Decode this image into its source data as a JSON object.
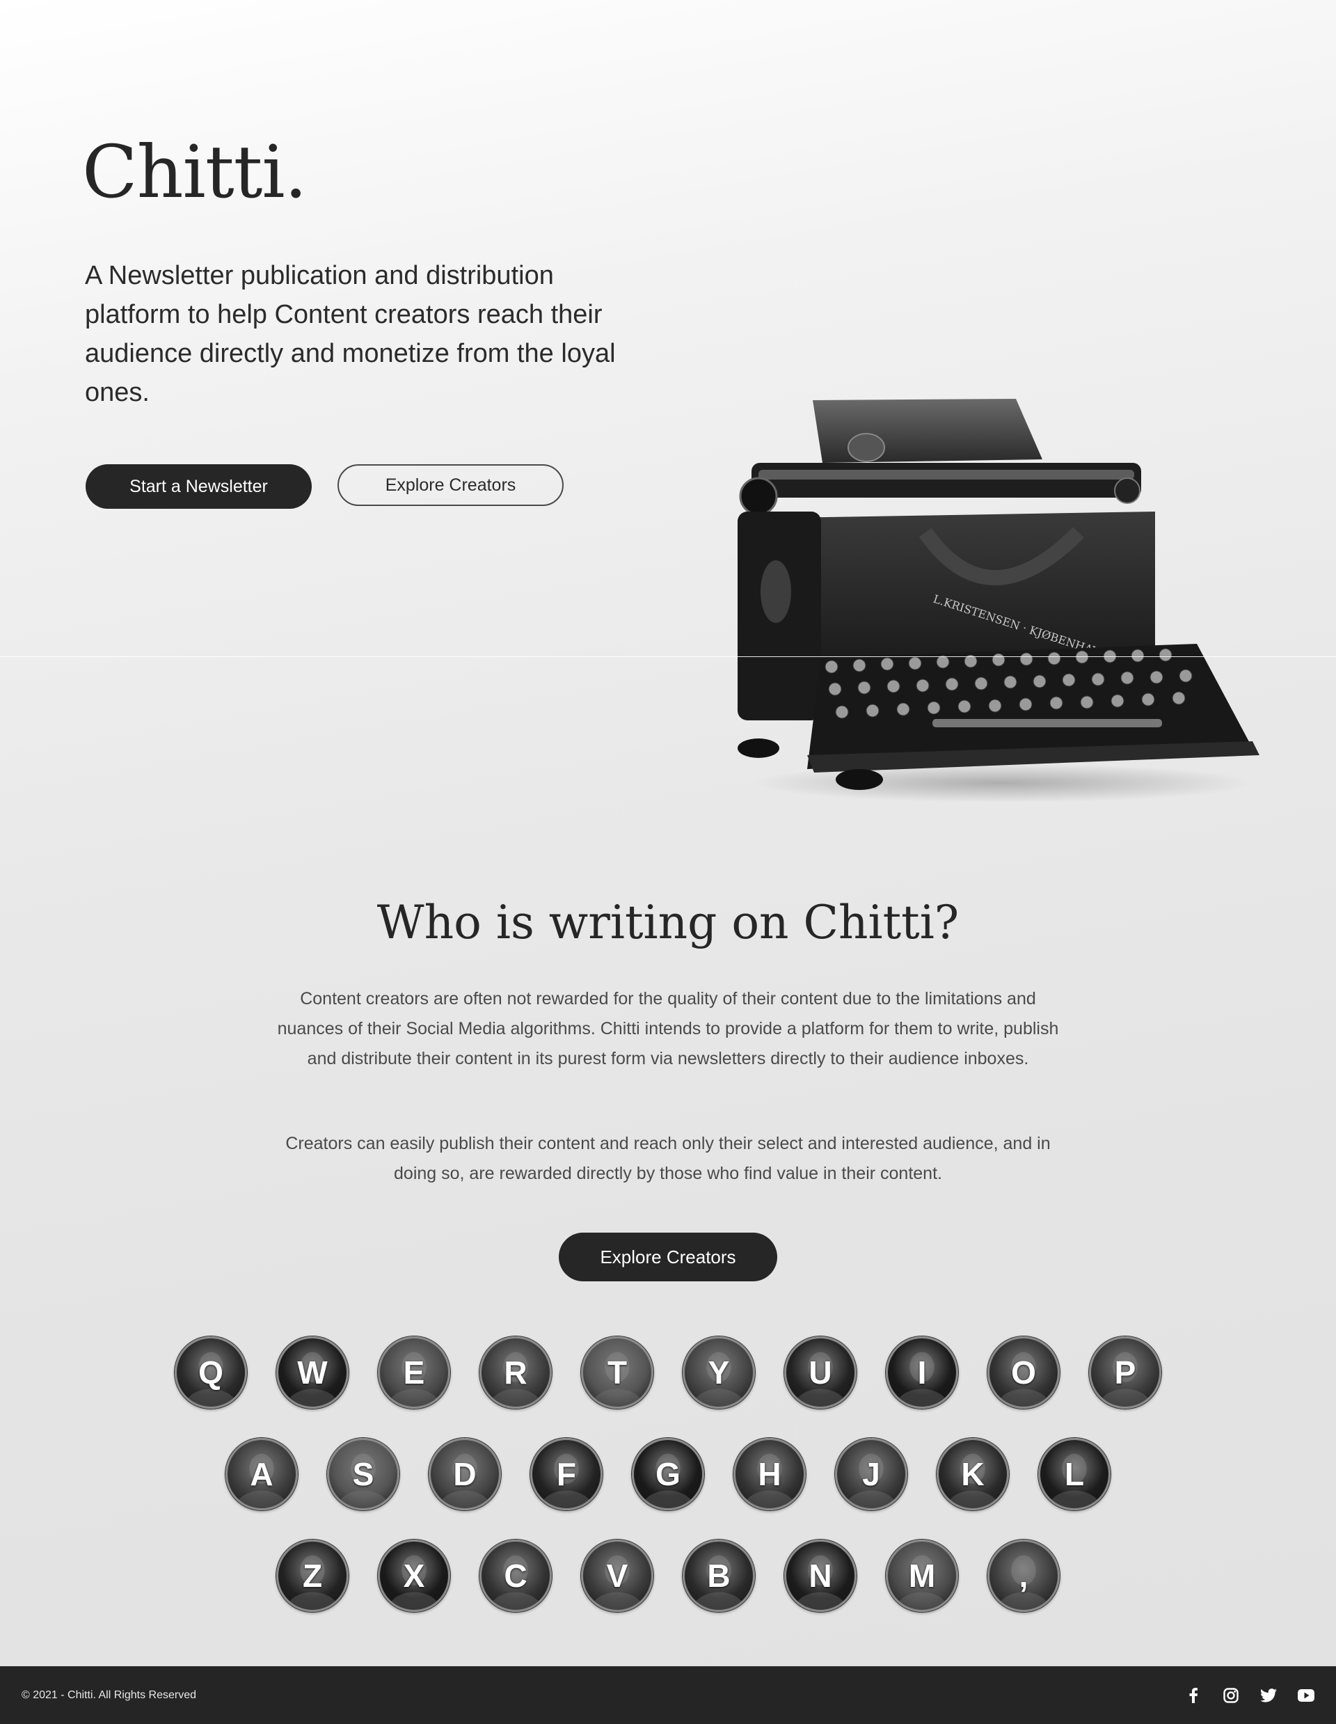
{
  "hero": {
    "logo": "Chitti.",
    "tagline": "A Newsletter publication and distribution platform to help Content creators reach their audience directly and monetize from the loyal ones.",
    "start_button": "Start a Newsletter",
    "explore_button": "Explore Creators"
  },
  "section": {
    "title": "Who is writing on Chitti?",
    "paragraph1": "Content creators are often not rewarded for the quality of their content due to the limitations and nuances of their Social Media algorithms. Chitti intends to provide a platform for them to write, publish and distribute their content in its purest form via newsletters directly to their audience inboxes.",
    "paragraph2": "Creators can easily publish their content and reach only their select and interested audience, and in doing so, are rewarded directly by those who find value in their content.",
    "explore_button": "Explore Creators"
  },
  "keyboard": {
    "row1": [
      "Q",
      "W",
      "E",
      "R",
      "T",
      "Y",
      "U",
      "I",
      "O",
      "P"
    ],
    "row2": [
      "A",
      "S",
      "D",
      "F",
      "G",
      "H",
      "J",
      "K",
      "L"
    ],
    "row3": [
      "Z",
      "X",
      "C",
      "V",
      "B",
      "N",
      "M",
      ","
    ]
  },
  "footer": {
    "copyright": "© 2021 - Chitti. All Rights Reserved",
    "social_icons": [
      "facebook-icon",
      "instagram-icon",
      "twitter-icon",
      "youtube-icon"
    ]
  },
  "colors": {
    "dark": "#262626",
    "footer_bg": "#252525",
    "text": "#2b2b2b"
  }
}
